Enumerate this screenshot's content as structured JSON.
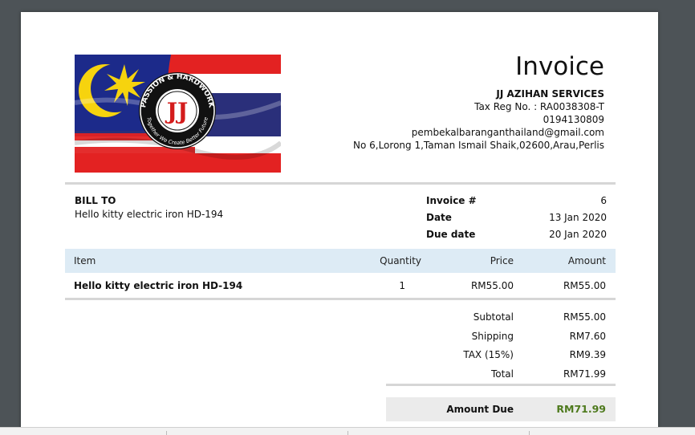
{
  "invoice": {
    "title": "Invoice",
    "company": {
      "name": "JJ AZIHAN SERVICES",
      "tax_reg": "Tax Reg No. : RA0038308-T",
      "phone": "0194130809",
      "email": "pembekalbaranganthailand@gmail.com",
      "address": "No 6,Lorong 1,Taman Ismail Shaik,02600,Arau,Perlis"
    },
    "logo": {
      "lettering_top": "PASSION & HARDWORK",
      "lettering_bottom": "Together We Create Better Future",
      "monogram": "JJ"
    },
    "bill_to": {
      "label": "BILL TO",
      "name": "Hello kitty electric iron HD-194"
    },
    "meta": [
      {
        "key": "Invoice #",
        "value": "6"
      },
      {
        "key": "Date",
        "value": "13 Jan 2020"
      },
      {
        "key": "Due date",
        "value": "20 Jan 2020"
      }
    ],
    "table": {
      "headers": {
        "item": "Item",
        "quantity": "Quantity",
        "price": "Price",
        "amount": "Amount"
      },
      "rows": [
        {
          "item": "Hello kitty electric iron HD-194",
          "quantity": "1",
          "price": "RM55.00",
          "amount": "RM55.00"
        }
      ]
    },
    "totals": [
      {
        "label": "Subtotal",
        "value": "RM55.00"
      },
      {
        "label": "Shipping",
        "value": "RM7.60"
      },
      {
        "label": "TAX (15%)",
        "value": "RM9.39"
      },
      {
        "label": "Total",
        "value": "RM71.99"
      }
    ],
    "amount_due": {
      "label": "Amount Due",
      "value": "RM71.99"
    }
  },
  "colors": {
    "table_header_bg": "#ddebf5",
    "amount_due_color": "#4e7a1d",
    "viewer_bg": "#4d5357"
  }
}
